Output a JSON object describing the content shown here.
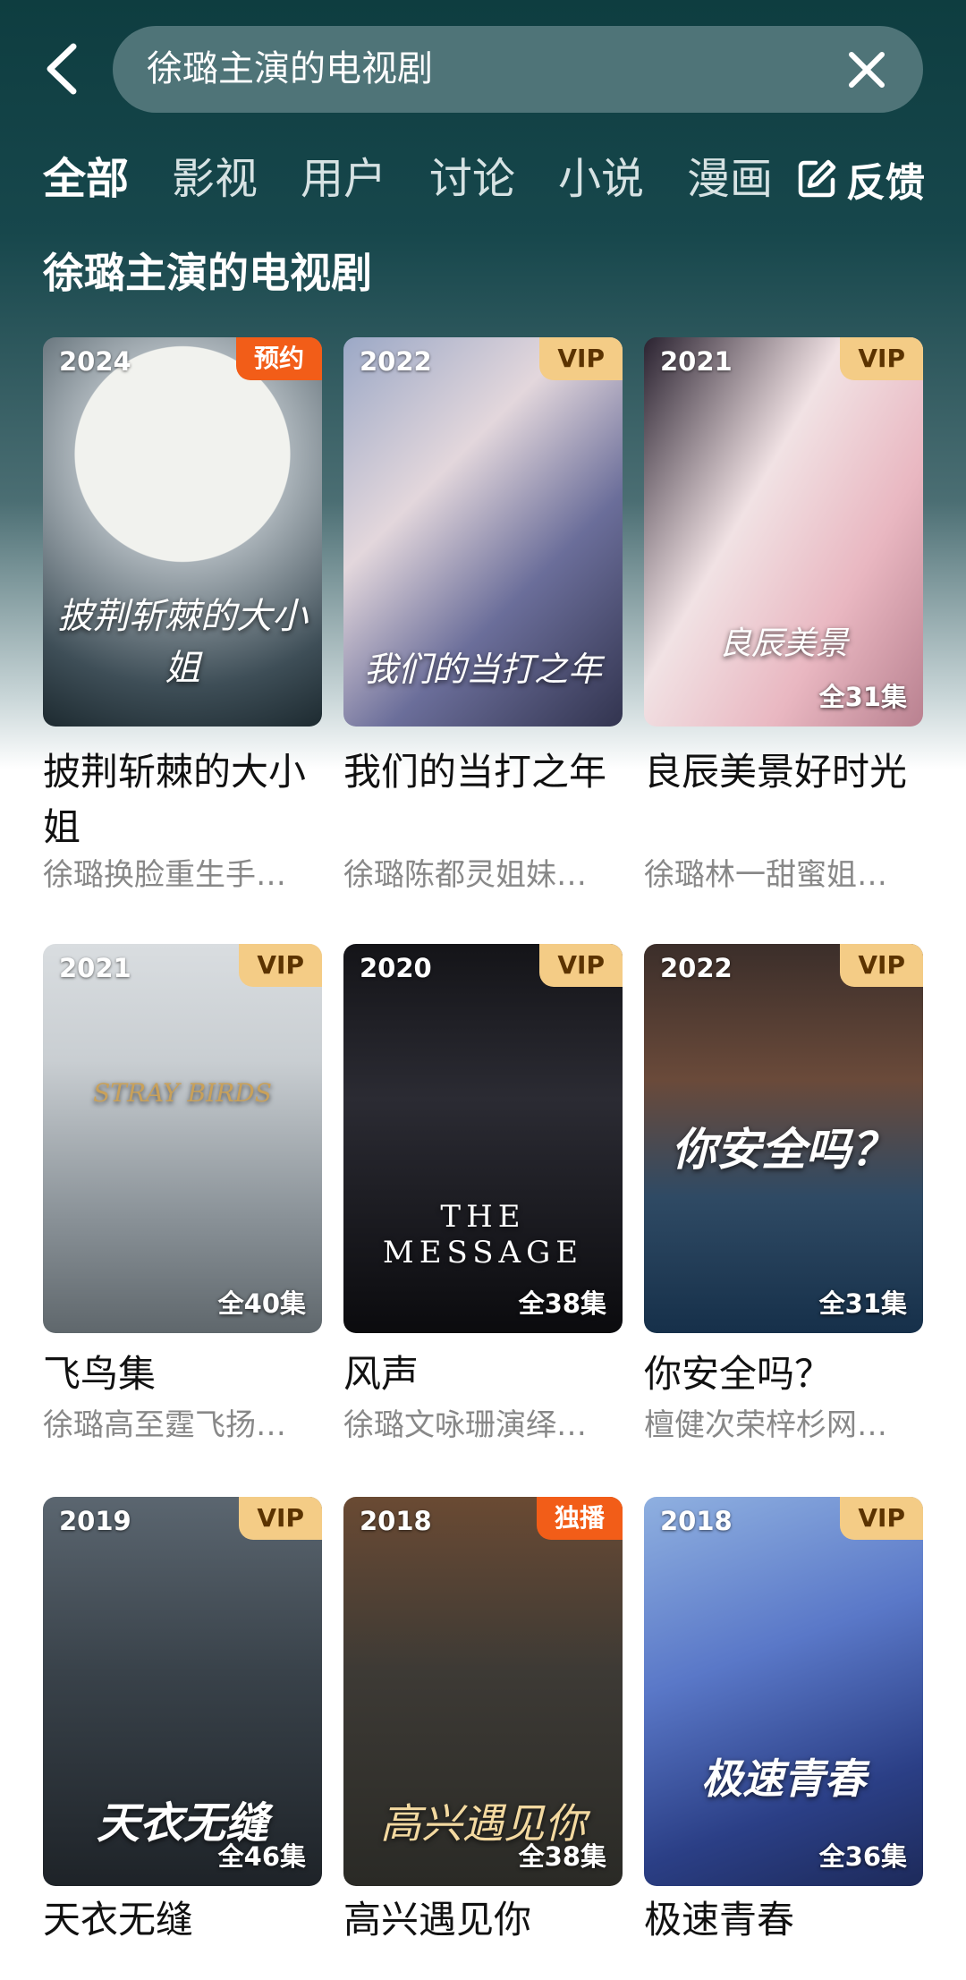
{
  "search": {
    "query": "徐璐主演的电视剧"
  },
  "tabs": [
    "全部",
    "影视",
    "用户",
    "讨论",
    "小说",
    "漫画"
  ],
  "feedback_label": "反馈",
  "section_title": "徐璐主演的电视剧",
  "cards": [
    {
      "year": "2024",
      "badge": "预约",
      "eps": "",
      "title": "披荆斩棘的大小姐",
      "sub": "徐璐换脸重生手…",
      "art": "披荆斩棘的大小姐"
    },
    {
      "year": "2022",
      "badge": "VIP",
      "eps": "",
      "title": "我们的当打之年",
      "sub": "徐璐陈都灵姐妹…",
      "art": "我们的当打之年"
    },
    {
      "year": "2021",
      "badge": "VIP",
      "eps": "全31集",
      "title": "良辰美景好时光",
      "sub": "徐璐林一甜蜜姐…",
      "art": "良辰美景"
    },
    {
      "year": "2021",
      "badge": "VIP",
      "eps": "全40集",
      "title": "飞鸟集",
      "sub": "徐璐高至霆飞扬…",
      "art": "STRAY BIRDS"
    },
    {
      "year": "2020",
      "badge": "VIP",
      "eps": "全38集",
      "title": "风声",
      "sub": "徐璐文咏珊演绎…",
      "art": "THE MESSAGE"
    },
    {
      "year": "2022",
      "badge": "VIP",
      "eps": "全31集",
      "title": "你安全吗？",
      "sub": "檀健次荣梓杉网…",
      "art": "你安全吗？"
    },
    {
      "year": "2019",
      "badge": "VIP",
      "eps": "全46集",
      "title": "天衣无缝",
      "sub": "",
      "art": "天衣无缝"
    },
    {
      "year": "2018",
      "badge": "独播",
      "eps": "全38集",
      "title": "高兴遇见你",
      "sub": "",
      "art": "高兴遇见你"
    },
    {
      "year": "2018",
      "badge": "VIP",
      "eps": "全36集",
      "title": "极速青春",
      "sub": "",
      "art": "极速青春"
    }
  ],
  "colors": {
    "header_bg": "#0e3d40",
    "vip_badge": "#f4cc86",
    "orange_badge": "#f25d18"
  }
}
